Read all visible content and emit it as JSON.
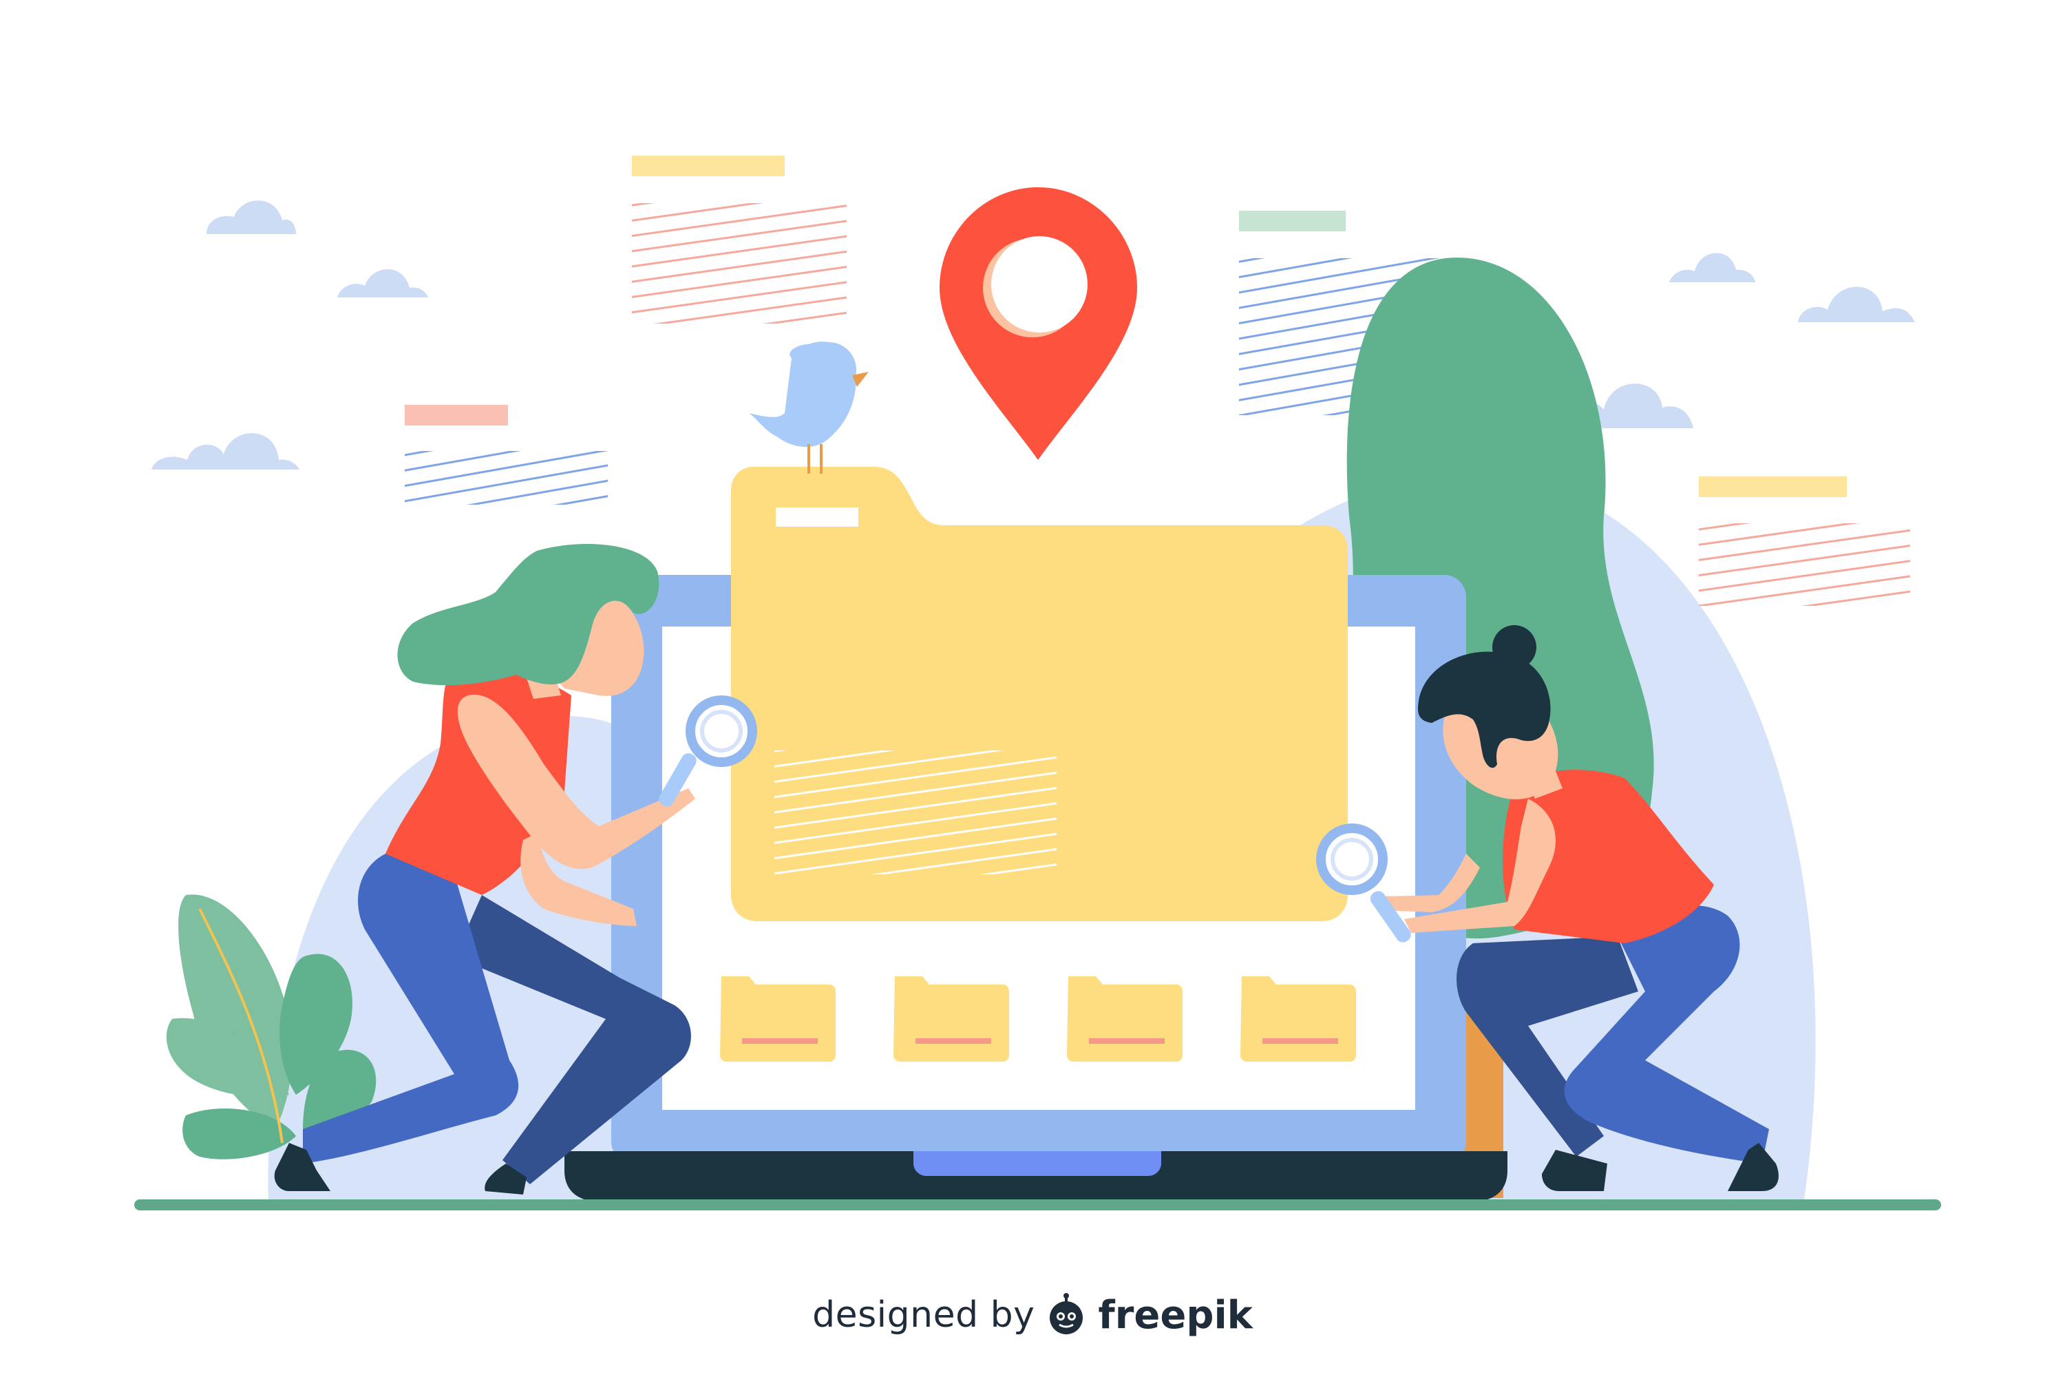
{
  "illustration": {
    "subject": "two people searching for files on a laptop",
    "icons": [
      "location-pin-icon",
      "folder-icon",
      "magnifier-icon",
      "bird-icon",
      "cloud-icon",
      "tree-icon",
      "plant-icon"
    ]
  },
  "credit": {
    "designed_by": "designed by",
    "brand": "freepik"
  },
  "colors": {
    "background": "#ffffff",
    "pin": "#fd523d",
    "folder": "#fedc80",
    "laptop_frame": "#93b8ef",
    "laptop_base": "#1c3340",
    "trackpad": "#6f8ff5",
    "tree": "#5fb28d",
    "trunk": "#e89b48",
    "hill": "#d6e3f8",
    "ground": "#5fa88a",
    "shirt": "#fd523d",
    "jeans": "#4369c2",
    "jeans_dark": "#33508f",
    "skin": "#fcc3a3",
    "hair_green": "#5fb28d",
    "hair_dark": "#1c3340",
    "bird": "#a9cbfa",
    "cloud": "#cddcf5",
    "text": "#1f2d3a"
  }
}
